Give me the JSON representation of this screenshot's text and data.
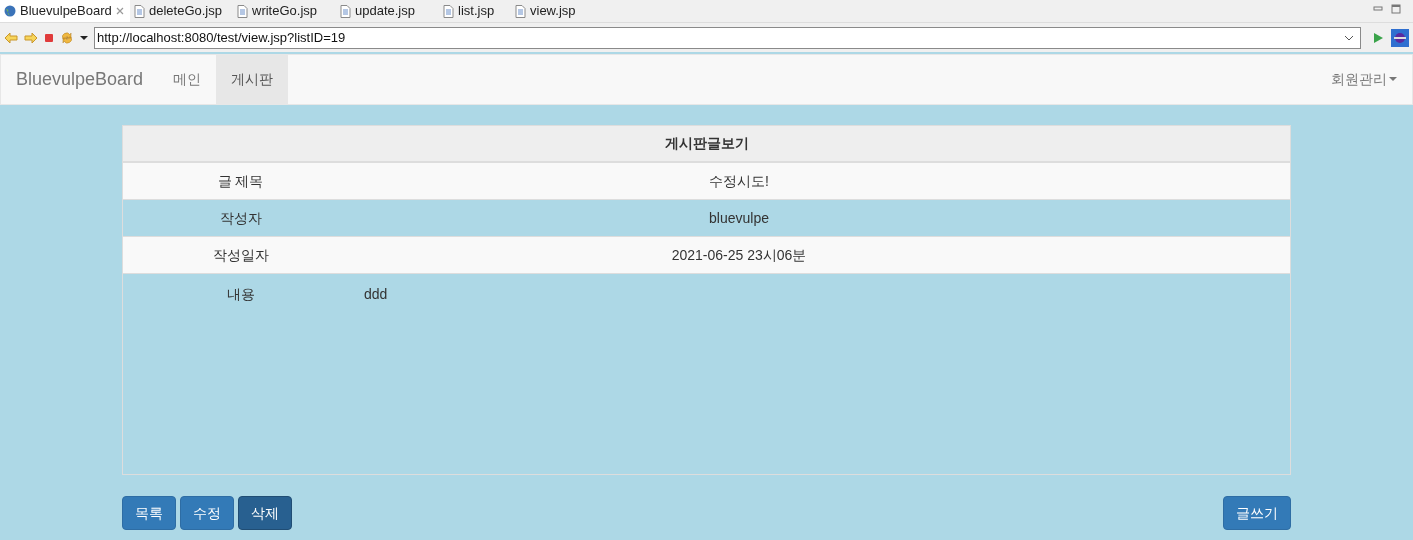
{
  "editor_tabs": [
    {
      "label": "BluevulpeBoard",
      "selected": true,
      "kind": "web"
    },
    {
      "label": "deleteGo.jsp",
      "selected": false,
      "kind": "file"
    },
    {
      "label": "writeGo.jsp",
      "selected": false,
      "kind": "file"
    },
    {
      "label": "update.jsp",
      "selected": false,
      "kind": "file"
    },
    {
      "label": "list.jsp",
      "selected": false,
      "kind": "file"
    },
    {
      "label": "view.jsp",
      "selected": false,
      "kind": "file"
    }
  ],
  "address_bar": {
    "value": "http://localhost:8080/test/view.jsp?listID=19"
  },
  "navbar": {
    "brand": "BluevulpeBoard",
    "items": [
      {
        "label": "메인",
        "selected": false
      },
      {
        "label": "게시판",
        "selected": true
      }
    ],
    "dropdown": "회원관리"
  },
  "table": {
    "title": "게시판글보기",
    "rows": [
      {
        "label": "글 제목",
        "value": "수정시도!",
        "kind": "centered"
      },
      {
        "label": "작성자",
        "value": "bluevulpe",
        "kind": "centered"
      },
      {
        "label": "작성일자",
        "value": "2021-06-25 23시06분",
        "kind": "centered"
      },
      {
        "label": "내용",
        "value": "ddd",
        "kind": "content"
      }
    ]
  },
  "buttons": [
    {
      "label": "목록",
      "focused": false
    },
    {
      "label": "수정",
      "focused": false
    },
    {
      "label": "삭제",
      "focused": true
    }
  ],
  "write_button": "글쓰기"
}
